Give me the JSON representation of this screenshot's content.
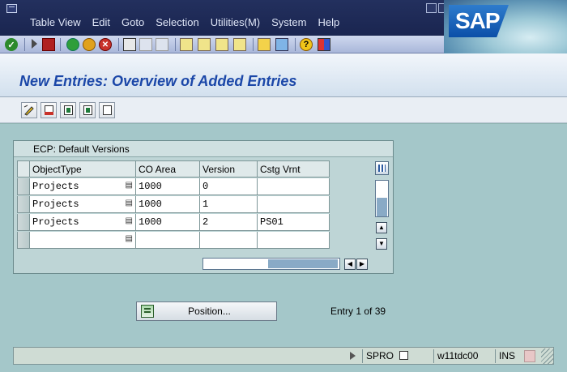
{
  "menubar": {
    "items": [
      "Table View",
      "Edit",
      "Goto",
      "Selection",
      "Utilities(M)",
      "System",
      "Help"
    ],
    "logo": "SAP"
  },
  "toolbar": {
    "icons": [
      "enter-icon",
      "command-field-icon",
      "save-icon",
      "back-icon",
      "exit-icon",
      "cancel-icon",
      "print-icon",
      "find-icon",
      "find-next-icon",
      "first-page-icon",
      "previous-page-icon",
      "next-page-icon",
      "last-page-icon",
      "create-session-icon",
      "shortcut-icon",
      "help-icon",
      "customize-layout-icon"
    ]
  },
  "title": "New Entries: Overview of Added Entries",
  "app_toolbar": {
    "icons": [
      "change-display-icon",
      "delete-icon",
      "select-all-icon",
      "select-block-icon",
      "deselect-all-icon"
    ]
  },
  "table": {
    "title": "ECP: Default Versions",
    "columns": [
      "ObjectType",
      "CO Area",
      "Version",
      "Cstg Vrnt"
    ],
    "rows": [
      {
        "object_type": "Projects",
        "co_area": "1000",
        "version": "0",
        "cstg_vrnt": ""
      },
      {
        "object_type": "Projects",
        "co_area": "1000",
        "version": "1",
        "cstg_vrnt": ""
      },
      {
        "object_type": "Projects",
        "co_area": "1000",
        "version": "2",
        "cstg_vrnt": "PS01"
      },
      {
        "object_type": "",
        "co_area": "",
        "version": "",
        "cstg_vrnt": ""
      }
    ],
    "f4_glyph": "▤"
  },
  "position_button": {
    "label": "Position..."
  },
  "entry_info": "Entry 1 of 39",
  "statusbar": {
    "transaction": "SPRO",
    "server": "w11tdc00",
    "mode": "INS"
  },
  "colors": {
    "title": "#1b47a8",
    "menubar": "#1a2550",
    "background": "#a4c7c9"
  }
}
